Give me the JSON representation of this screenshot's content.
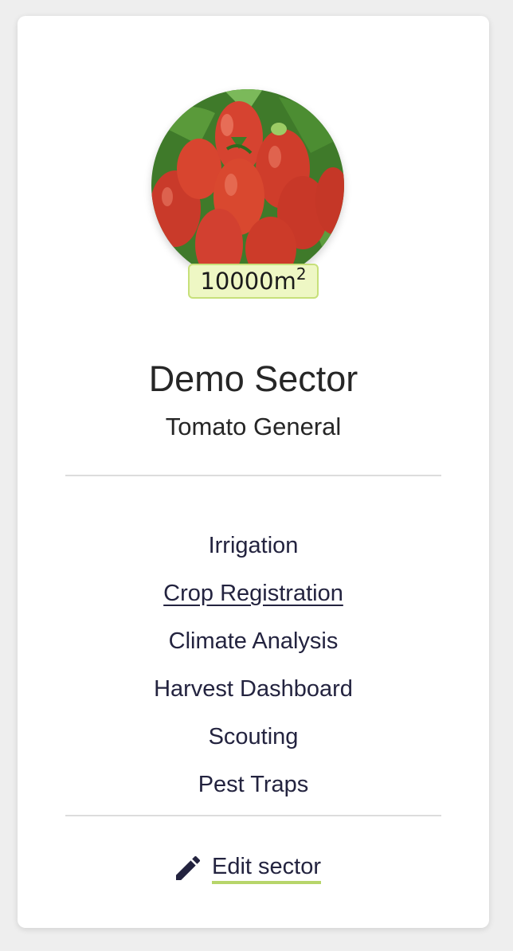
{
  "sector": {
    "area_value": "10000m",
    "area_unit_exponent": "2",
    "name": "Demo Sector",
    "crop": "Tomato General"
  },
  "nav": {
    "items": [
      {
        "label": "Irrigation"
      },
      {
        "label": "Crop Registration"
      },
      {
        "label": "Climate Analysis"
      },
      {
        "label": "Harvest Dashboard"
      },
      {
        "label": "Scouting"
      },
      {
        "label": "Pest Traps"
      }
    ]
  },
  "actions": {
    "edit_label": "Edit sector"
  },
  "colors": {
    "text_dark": "#23233f",
    "badge_bg": "#eef7c4",
    "badge_border": "#c7e07a",
    "accent_underline": "#b7d56a"
  }
}
